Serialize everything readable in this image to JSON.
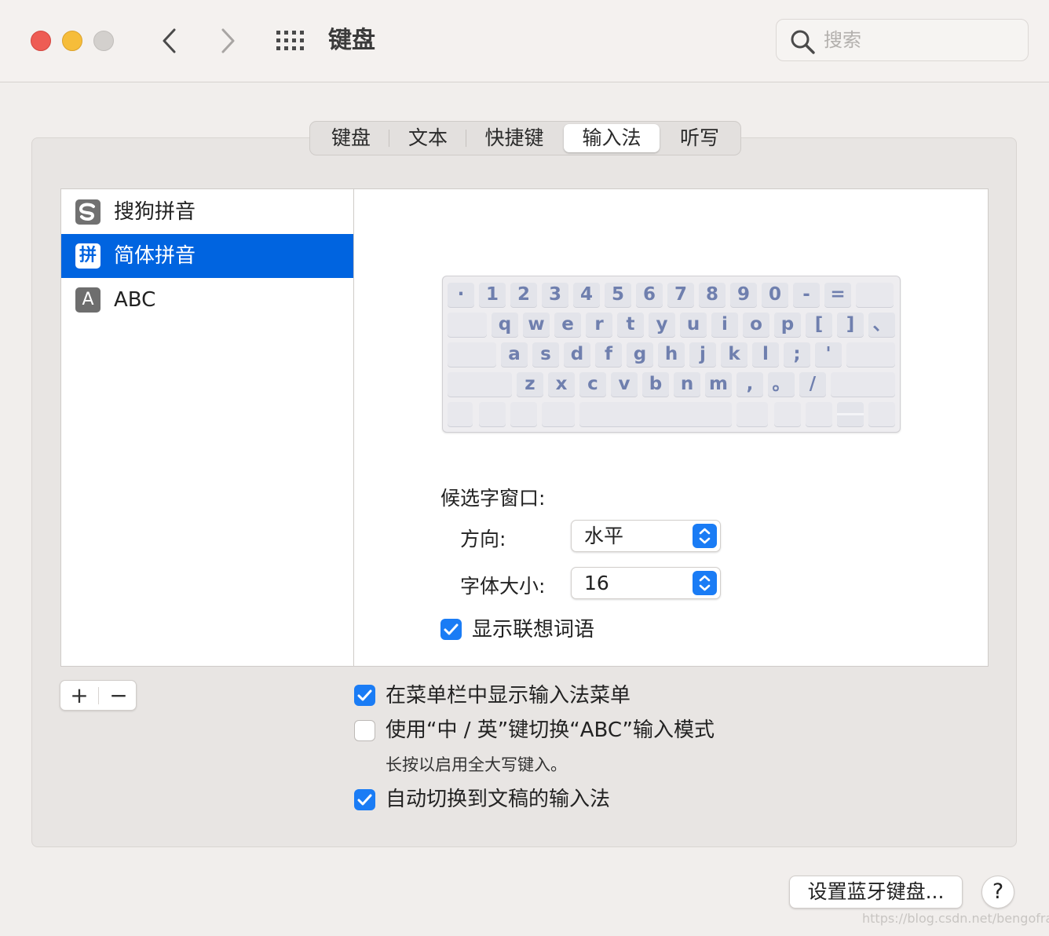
{
  "window": {
    "title": "键盘",
    "search_placeholder": "搜索"
  },
  "tabs": [
    "键盘",
    "文本",
    "快捷键",
    "输入法",
    "听写"
  ],
  "active_tab": "输入法",
  "input_sources": [
    {
      "name": "搜狗拼音",
      "icon": "sogou-icon",
      "glyph": "S"
    },
    {
      "name": "简体拼音",
      "icon": "pinyin-icon",
      "glyph": "拼",
      "selected": true
    },
    {
      "name": "ABC",
      "icon": "abc-icon",
      "glyph": "A"
    }
  ],
  "keyboard": {
    "row1": [
      "·",
      "1",
      "2",
      "3",
      "4",
      "5",
      "6",
      "7",
      "8",
      "9",
      "0",
      "-",
      "="
    ],
    "row2": [
      "q",
      "w",
      "e",
      "r",
      "t",
      "y",
      "u",
      "i",
      "o",
      "p",
      "[",
      "]",
      "、"
    ],
    "row3": [
      "a",
      "s",
      "d",
      "f",
      "g",
      "h",
      "j",
      "k",
      "l",
      ";",
      "'"
    ],
    "row4": [
      "z",
      "x",
      "c",
      "v",
      "b",
      "n",
      "m",
      ",",
      "。",
      "/"
    ]
  },
  "candidate_window": {
    "label": "候选字窗口:",
    "direction_label": "方向:",
    "direction_value": "水平",
    "font_size_label": "字体大小:",
    "font_size_value": "16",
    "show_predictions_label": "显示联想词语",
    "show_predictions_checked": true
  },
  "list_controls": {
    "add": "+",
    "remove": "−"
  },
  "options": {
    "show_menu_label": "在菜单栏中显示输入法菜单",
    "show_menu_checked": true,
    "switch_abc_label": "使用“中 / 英”键切换“ABC”输入模式",
    "switch_abc_checked": false,
    "switch_abc_hint": "长按以启用全大写键入。",
    "auto_switch_label": "自动切换到文稿的输入法",
    "auto_switch_checked": true
  },
  "footer": {
    "bluetooth_button": "设置蓝牙键盘...",
    "help_button": "?"
  },
  "watermark": "https://blog.csdn.net/bengofrank",
  "colors": {
    "accent": "#1a7cf5",
    "selection": "#0064e0",
    "key_text": "#6f7fae"
  }
}
